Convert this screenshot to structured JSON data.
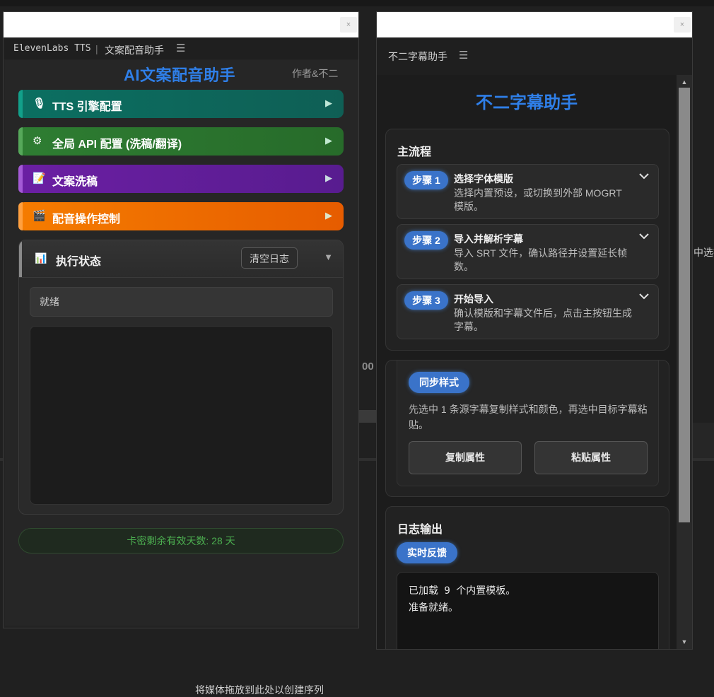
{
  "left_panel": {
    "tab_title": "ElevenLabs TTS",
    "tab_separator": "|",
    "tab_subtitle": "文案配音助手",
    "menu_icon": "☰",
    "close_icon": "×",
    "title": "AI文案配音助手",
    "author": "作者&不二",
    "sections": [
      {
        "icon": "microphone-icon",
        "glyph": "🎙",
        "label": "TTS 引擎配置",
        "arrow": "▶",
        "color": "#0e7a6a"
      },
      {
        "icon": "gear-icon",
        "glyph": "⚙",
        "label": "全局 API 配置 (洗稿/翻译)",
        "arrow": "▶",
        "color": "#2f7d32"
      },
      {
        "icon": "memo-icon",
        "glyph": "📝",
        "label": "文案洗稿",
        "arrow": "▶",
        "color": "#6a1fa2"
      },
      {
        "icon": "clapperboard-icon",
        "glyph": "🎬",
        "label": "配音操作控制",
        "arrow": "▶",
        "color": "#ef6c00"
      }
    ],
    "status": {
      "glyph": "📊",
      "label": "执行状态",
      "clear_button": "清空日志",
      "collapse_arrow": "▼",
      "ready_text": "就绪"
    },
    "license_text": "卡密剩余有效天数: 28 天"
  },
  "right_panel": {
    "tab_title": "不二字幕助手",
    "menu_icon": "☰",
    "close_icon": "×",
    "title": "不二字幕助手",
    "main_flow": {
      "title": "主流程",
      "steps": [
        {
          "badge": "步骤 1",
          "title": "选择字体模版",
          "desc": "选择内置预设，或切换到外部 MOGRT 模版。"
        },
        {
          "badge": "步骤 2",
          "title": "导入并解析字幕",
          "desc": "导入 SRT 文件，确认路径并设置延长帧数。"
        },
        {
          "badge": "步骤 3",
          "title": "开始导入",
          "desc": "确认模版和字幕文件后，点击主按钮生成字幕。"
        }
      ]
    },
    "sync_style": {
      "pill": "同步样式",
      "desc": "先选中 1 条源字幕复制样式和颜色，再选中目标字幕粘贴。",
      "copy_button": "复制属性",
      "paste_button": "粘贴属性"
    },
    "log": {
      "title": "日志输出",
      "pill": "实时反馈",
      "lines": [
        "已加载 9 个内置模板。",
        "准备就绪。"
      ]
    },
    "scroll_up": "▲",
    "scroll_down": "▼"
  },
  "background": {
    "timecode_fragment": "00",
    "right_fragment": "中选择",
    "bottom_fragment": "将媒体拖放到此处以创建序列"
  }
}
